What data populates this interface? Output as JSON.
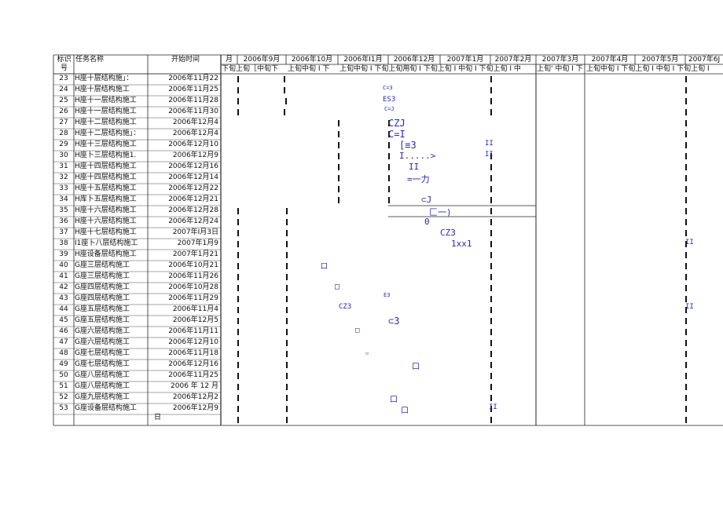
{
  "header": {
    "col_id": [
      "标识",
      "号"
    ],
    "col_name": "任务名称",
    "col_start": "开始时间",
    "months": [
      "月",
      "2006年9月",
      "2006年10月",
      "2006年I1月",
      "2006年12月",
      "2007年1月",
      "2007年2月",
      "2007年3月",
      "2007年4月",
      "2007年5月",
      "2007年6J"
    ],
    "subheader": [
      "下旬上旬［中旬下",
      "上旬中旬 I 下",
      "上旬中旬 I 下旬上旬用旬 I 下旬上旬 I 中旬 I 下旬上旬 I 中",
      "上旬' 中旬 I 下",
      "上旬中旬 I 下旬上旬 I 中旬 I 下旬上旬 I"
    ]
  },
  "rows": [
    {
      "id": "23",
      "name": "H座十层结构施」：",
      "start": "2006年11月22"
    },
    {
      "id": "24",
      "name": "H座十层结构施工",
      "start": "2006年11月25"
    },
    {
      "id": "25",
      "name": "H座十一层结构施工",
      "start": "2006年11月28"
    },
    {
      "id": "26",
      "name": "H座十一层结构施工",
      "start": "2006年11月30"
    },
    {
      "id": "27",
      "name": "H座十二层结构施工",
      "start": "2006年12月4"
    },
    {
      "id": "28",
      "name": "H座十二层结构施」：",
      "start": "2006年12月4"
    },
    {
      "id": "29",
      "name": "H座十三层结构施工",
      "start": "2006年12月10"
    },
    {
      "id": "30",
      "name": "H座卜三层结构施1.",
      "start": "2006年12月9"
    },
    {
      "id": "31",
      "name": "H座十四层结构施工",
      "start": "2006年12月16"
    },
    {
      "id": "32",
      "name": "H座十四层结构施工",
      "start": "2006年12月14"
    },
    {
      "id": "33",
      "name": "H座十五层结构施工",
      "start": "2006年12月22"
    },
    {
      "id": "34",
      "name": "H库卜五层结构施工",
      "start": "2006年12月21"
    },
    {
      "id": "35",
      "name": "H座十六层结构施工",
      "start": "2006年12月28"
    },
    {
      "id": "36",
      "name": "H座十六层结构施工",
      "start": "2006年12月24"
    },
    {
      "id": "37",
      "name": "H座十七层结构施工",
      "start": "2007年I月3日"
    },
    {
      "id": "38",
      "name": "I1座卜八层结构施工",
      "start": "2007年1月9"
    },
    {
      "id": "39",
      "name": "H座设备层结构施工",
      "start": "2007年1月21"
    },
    {
      "id": "40",
      "name": "G座三层结构施工",
      "start": "2006年10月21"
    },
    {
      "id": "41",
      "name": "G座三层结构施工",
      "start": "2006年11月26"
    },
    {
      "id": "42",
      "name": "G座四层结构施工",
      "start": "2006年10月28"
    },
    {
      "id": "43",
      "name": "G座四层结构施工",
      "start": "2006年11月29"
    },
    {
      "id": "44",
      "name": "G座五层结构施工",
      "start": "2006年11月4"
    },
    {
      "id": "45",
      "name": "G座五层结构施工",
      "start": "2006年12月5"
    },
    {
      "id": "46",
      "name": "G座六层结构施工",
      "start": "2006年11月11"
    },
    {
      "id": "47",
      "name": "G座六层结构施工",
      "start": "2006年12月10"
    },
    {
      "id": "48",
      "name": "G座七层结构施工",
      "start": "2006年11月18"
    },
    {
      "id": "49",
      "name": "G座七层结构施工",
      "start": "2006年12月16"
    },
    {
      "id": "50",
      "name": "G座八层结构施工",
      "start": "2006年11月25"
    },
    {
      "id": "51",
      "name": "G座八层结构施工",
      "start": "2006 年 12 月"
    },
    {
      "id": "52",
      "name": "G座九层结构施工",
      "start": "2006年12月2"
    },
    {
      "id": "53",
      "name": "G座设备层结构施工",
      "start": "2006年12月9"
    }
  ],
  "trailing_char": "日",
  "bar_glyphs": [
    "C=3",
    "ES3",
    "C=J",
    "CZJ",
    "C=I",
    "[≡3",
    "I.....>",
    "II",
    "=一力",
    "⊂J",
    "匚一)",
    "0",
    "CZ3",
    "1xx1",
    "口",
    "□",
    "E3",
    "CZ3",
    "⊂3",
    "□",
    "▫",
    "口",
    "口",
    "口",
    "II",
    "II",
    "II",
    "II",
    "II"
  ],
  "colors": {
    "grid": "#222222",
    "bars": "#2a2ab0"
  }
}
